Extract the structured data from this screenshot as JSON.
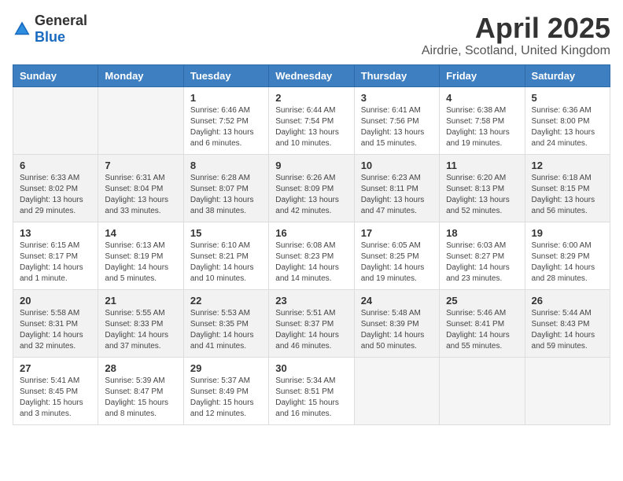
{
  "header": {
    "logo_general": "General",
    "logo_blue": "Blue",
    "month_title": "April 2025",
    "location": "Airdrie, Scotland, United Kingdom"
  },
  "columns": [
    "Sunday",
    "Monday",
    "Tuesday",
    "Wednesday",
    "Thursday",
    "Friday",
    "Saturday"
  ],
  "weeks": [
    [
      {
        "day": "",
        "sunrise": "",
        "sunset": "",
        "daylight": ""
      },
      {
        "day": "",
        "sunrise": "",
        "sunset": "",
        "daylight": ""
      },
      {
        "day": "1",
        "sunrise": "Sunrise: 6:46 AM",
        "sunset": "Sunset: 7:52 PM",
        "daylight": "Daylight: 13 hours and 6 minutes."
      },
      {
        "day": "2",
        "sunrise": "Sunrise: 6:44 AM",
        "sunset": "Sunset: 7:54 PM",
        "daylight": "Daylight: 13 hours and 10 minutes."
      },
      {
        "day": "3",
        "sunrise": "Sunrise: 6:41 AM",
        "sunset": "Sunset: 7:56 PM",
        "daylight": "Daylight: 13 hours and 15 minutes."
      },
      {
        "day": "4",
        "sunrise": "Sunrise: 6:38 AM",
        "sunset": "Sunset: 7:58 PM",
        "daylight": "Daylight: 13 hours and 19 minutes."
      },
      {
        "day": "5",
        "sunrise": "Sunrise: 6:36 AM",
        "sunset": "Sunset: 8:00 PM",
        "daylight": "Daylight: 13 hours and 24 minutes."
      }
    ],
    [
      {
        "day": "6",
        "sunrise": "Sunrise: 6:33 AM",
        "sunset": "Sunset: 8:02 PM",
        "daylight": "Daylight: 13 hours and 29 minutes."
      },
      {
        "day": "7",
        "sunrise": "Sunrise: 6:31 AM",
        "sunset": "Sunset: 8:04 PM",
        "daylight": "Daylight: 13 hours and 33 minutes."
      },
      {
        "day": "8",
        "sunrise": "Sunrise: 6:28 AM",
        "sunset": "Sunset: 8:07 PM",
        "daylight": "Daylight: 13 hours and 38 minutes."
      },
      {
        "day": "9",
        "sunrise": "Sunrise: 6:26 AM",
        "sunset": "Sunset: 8:09 PM",
        "daylight": "Daylight: 13 hours and 42 minutes."
      },
      {
        "day": "10",
        "sunrise": "Sunrise: 6:23 AM",
        "sunset": "Sunset: 8:11 PM",
        "daylight": "Daylight: 13 hours and 47 minutes."
      },
      {
        "day": "11",
        "sunrise": "Sunrise: 6:20 AM",
        "sunset": "Sunset: 8:13 PM",
        "daylight": "Daylight: 13 hours and 52 minutes."
      },
      {
        "day": "12",
        "sunrise": "Sunrise: 6:18 AM",
        "sunset": "Sunset: 8:15 PM",
        "daylight": "Daylight: 13 hours and 56 minutes."
      }
    ],
    [
      {
        "day": "13",
        "sunrise": "Sunrise: 6:15 AM",
        "sunset": "Sunset: 8:17 PM",
        "daylight": "Daylight: 14 hours and 1 minute."
      },
      {
        "day": "14",
        "sunrise": "Sunrise: 6:13 AM",
        "sunset": "Sunset: 8:19 PM",
        "daylight": "Daylight: 14 hours and 5 minutes."
      },
      {
        "day": "15",
        "sunrise": "Sunrise: 6:10 AM",
        "sunset": "Sunset: 8:21 PM",
        "daylight": "Daylight: 14 hours and 10 minutes."
      },
      {
        "day": "16",
        "sunrise": "Sunrise: 6:08 AM",
        "sunset": "Sunset: 8:23 PM",
        "daylight": "Daylight: 14 hours and 14 minutes."
      },
      {
        "day": "17",
        "sunrise": "Sunrise: 6:05 AM",
        "sunset": "Sunset: 8:25 PM",
        "daylight": "Daylight: 14 hours and 19 minutes."
      },
      {
        "day": "18",
        "sunrise": "Sunrise: 6:03 AM",
        "sunset": "Sunset: 8:27 PM",
        "daylight": "Daylight: 14 hours and 23 minutes."
      },
      {
        "day": "19",
        "sunrise": "Sunrise: 6:00 AM",
        "sunset": "Sunset: 8:29 PM",
        "daylight": "Daylight: 14 hours and 28 minutes."
      }
    ],
    [
      {
        "day": "20",
        "sunrise": "Sunrise: 5:58 AM",
        "sunset": "Sunset: 8:31 PM",
        "daylight": "Daylight: 14 hours and 32 minutes."
      },
      {
        "day": "21",
        "sunrise": "Sunrise: 5:55 AM",
        "sunset": "Sunset: 8:33 PM",
        "daylight": "Daylight: 14 hours and 37 minutes."
      },
      {
        "day": "22",
        "sunrise": "Sunrise: 5:53 AM",
        "sunset": "Sunset: 8:35 PM",
        "daylight": "Daylight: 14 hours and 41 minutes."
      },
      {
        "day": "23",
        "sunrise": "Sunrise: 5:51 AM",
        "sunset": "Sunset: 8:37 PM",
        "daylight": "Daylight: 14 hours and 46 minutes."
      },
      {
        "day": "24",
        "sunrise": "Sunrise: 5:48 AM",
        "sunset": "Sunset: 8:39 PM",
        "daylight": "Daylight: 14 hours and 50 minutes."
      },
      {
        "day": "25",
        "sunrise": "Sunrise: 5:46 AM",
        "sunset": "Sunset: 8:41 PM",
        "daylight": "Daylight: 14 hours and 55 minutes."
      },
      {
        "day": "26",
        "sunrise": "Sunrise: 5:44 AM",
        "sunset": "Sunset: 8:43 PM",
        "daylight": "Daylight: 14 hours and 59 minutes."
      }
    ],
    [
      {
        "day": "27",
        "sunrise": "Sunrise: 5:41 AM",
        "sunset": "Sunset: 8:45 PM",
        "daylight": "Daylight: 15 hours and 3 minutes."
      },
      {
        "day": "28",
        "sunrise": "Sunrise: 5:39 AM",
        "sunset": "Sunset: 8:47 PM",
        "daylight": "Daylight: 15 hours and 8 minutes."
      },
      {
        "day": "29",
        "sunrise": "Sunrise: 5:37 AM",
        "sunset": "Sunset: 8:49 PM",
        "daylight": "Daylight: 15 hours and 12 minutes."
      },
      {
        "day": "30",
        "sunrise": "Sunrise: 5:34 AM",
        "sunset": "Sunset: 8:51 PM",
        "daylight": "Daylight: 15 hours and 16 minutes."
      },
      {
        "day": "",
        "sunrise": "",
        "sunset": "",
        "daylight": ""
      },
      {
        "day": "",
        "sunrise": "",
        "sunset": "",
        "daylight": ""
      },
      {
        "day": "",
        "sunrise": "",
        "sunset": "",
        "daylight": ""
      }
    ]
  ]
}
